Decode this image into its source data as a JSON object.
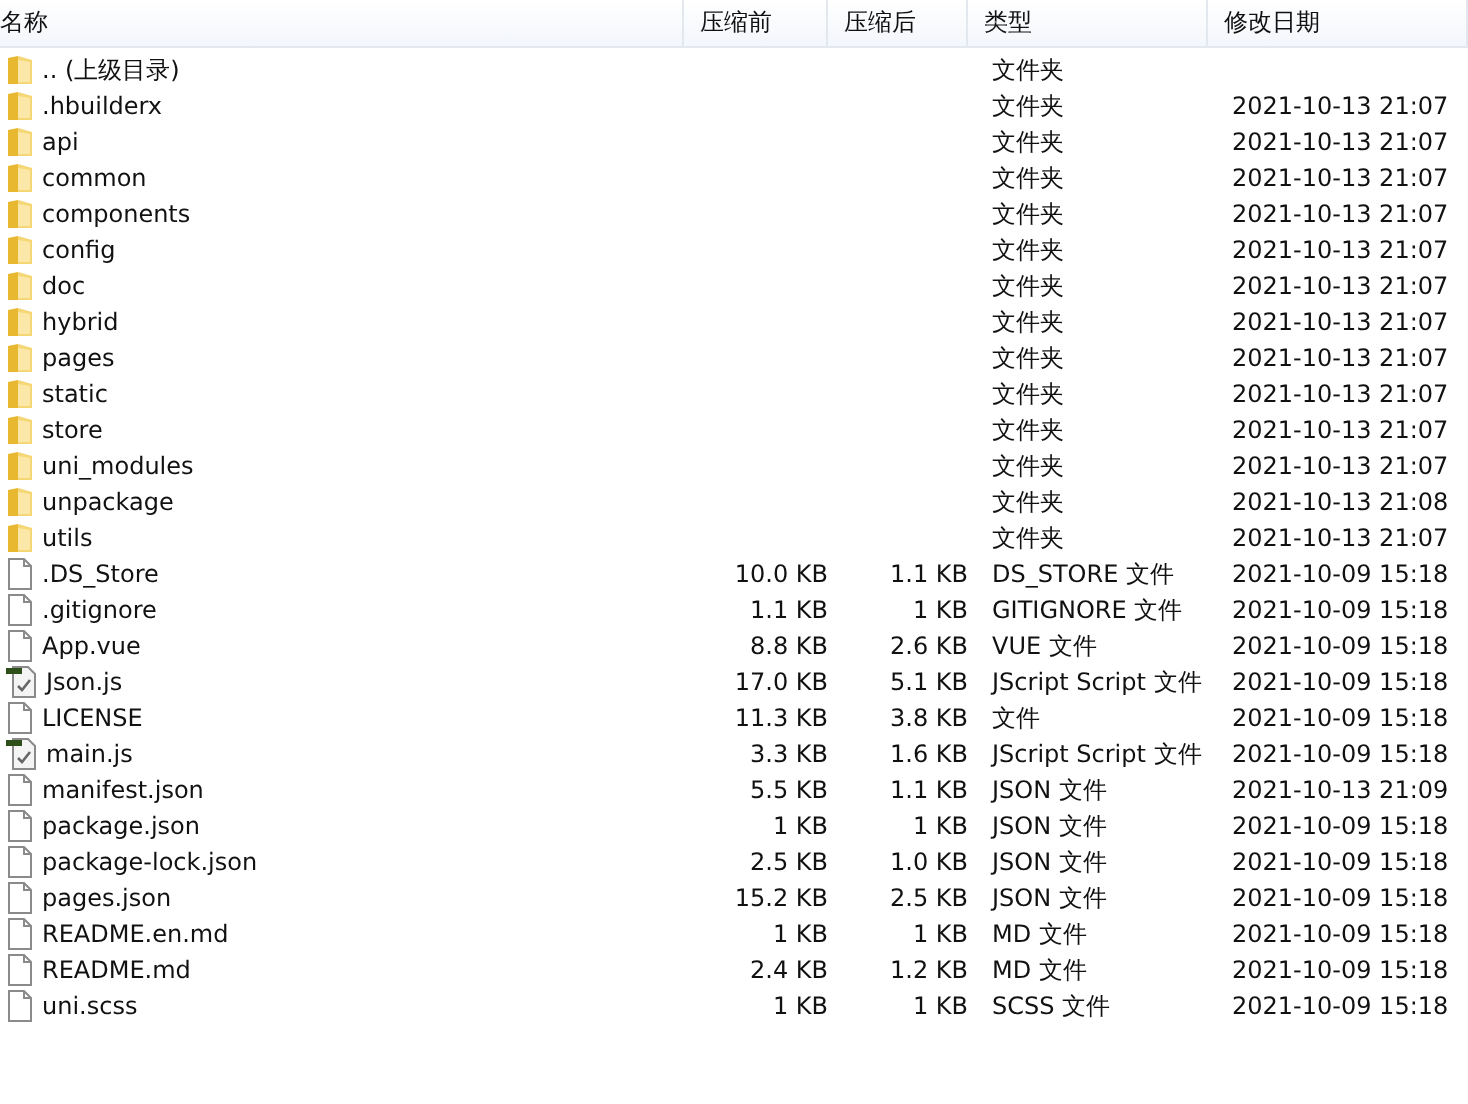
{
  "columns": [
    "名称",
    "压缩前",
    "压缩后",
    "类型",
    "修改日期"
  ],
  "rows": [
    {
      "kind": "folder",
      "name": ".. (上级目录)",
      "before": "",
      "after": "",
      "type": "文件夹",
      "date": ""
    },
    {
      "kind": "folder",
      "name": ".hbuilderx",
      "before": "",
      "after": "",
      "type": "文件夹",
      "date": "2021-10-13 21:07"
    },
    {
      "kind": "folder",
      "name": "api",
      "before": "",
      "after": "",
      "type": "文件夹",
      "date": "2021-10-13 21:07"
    },
    {
      "kind": "folder",
      "name": "common",
      "before": "",
      "after": "",
      "type": "文件夹",
      "date": "2021-10-13 21:07"
    },
    {
      "kind": "folder",
      "name": "components",
      "before": "",
      "after": "",
      "type": "文件夹",
      "date": "2021-10-13 21:07"
    },
    {
      "kind": "folder",
      "name": "config",
      "before": "",
      "after": "",
      "type": "文件夹",
      "date": "2021-10-13 21:07"
    },
    {
      "kind": "folder",
      "name": "doc",
      "before": "",
      "after": "",
      "type": "文件夹",
      "date": "2021-10-13 21:07"
    },
    {
      "kind": "folder",
      "name": "hybrid",
      "before": "",
      "after": "",
      "type": "文件夹",
      "date": "2021-10-13 21:07"
    },
    {
      "kind": "folder",
      "name": "pages",
      "before": "",
      "after": "",
      "type": "文件夹",
      "date": "2021-10-13 21:07"
    },
    {
      "kind": "folder",
      "name": "static",
      "before": "",
      "after": "",
      "type": "文件夹",
      "date": "2021-10-13 21:07"
    },
    {
      "kind": "folder",
      "name": "store",
      "before": "",
      "after": "",
      "type": "文件夹",
      "date": "2021-10-13 21:07"
    },
    {
      "kind": "folder",
      "name": "uni_modules",
      "before": "",
      "after": "",
      "type": "文件夹",
      "date": "2021-10-13 21:07"
    },
    {
      "kind": "folder",
      "name": "unpackage",
      "before": "",
      "after": "",
      "type": "文件夹",
      "date": "2021-10-13 21:08"
    },
    {
      "kind": "folder",
      "name": "utils",
      "before": "",
      "after": "",
      "type": "文件夹",
      "date": "2021-10-13 21:07"
    },
    {
      "kind": "file",
      "name": ".DS_Store",
      "before": "10.0 KB",
      "after": "1.1 KB",
      "type": "DS_STORE 文件",
      "date": "2021-10-09 15:18"
    },
    {
      "kind": "file",
      "name": ".gitignore",
      "before": "1.1 KB",
      "after": "1 KB",
      "type": "GITIGNORE 文件",
      "date": "2021-10-09 15:18"
    },
    {
      "kind": "file",
      "name": "App.vue",
      "before": "8.8 KB",
      "after": "2.6 KB",
      "type": "VUE 文件",
      "date": "2021-10-09 15:18"
    },
    {
      "kind": "script",
      "name": "Json.js",
      "before": "17.0 KB",
      "after": "5.1 KB",
      "type": "JScript Script 文件",
      "date": "2021-10-09 15:18"
    },
    {
      "kind": "file",
      "name": "LICENSE",
      "before": "11.3 KB",
      "after": "3.8 KB",
      "type": "文件",
      "date": "2021-10-09 15:18"
    },
    {
      "kind": "script",
      "name": "main.js",
      "before": "3.3 KB",
      "after": "1.6 KB",
      "type": "JScript Script 文件",
      "date": "2021-10-09 15:18"
    },
    {
      "kind": "file",
      "name": "manifest.json",
      "before": "5.5 KB",
      "after": "1.1 KB",
      "type": "JSON 文件",
      "date": "2021-10-13 21:09"
    },
    {
      "kind": "file",
      "name": "package.json",
      "before": "1 KB",
      "after": "1 KB",
      "type": "JSON 文件",
      "date": "2021-10-09 15:18"
    },
    {
      "kind": "file",
      "name": "package-lock.json",
      "before": "2.5 KB",
      "after": "1.0 KB",
      "type": "JSON 文件",
      "date": "2021-10-09 15:18"
    },
    {
      "kind": "file",
      "name": "pages.json",
      "before": "15.2 KB",
      "after": "2.5 KB",
      "type": "JSON 文件",
      "date": "2021-10-09 15:18"
    },
    {
      "kind": "file",
      "name": "README.en.md",
      "before": "1 KB",
      "after": "1 KB",
      "type": "MD 文件",
      "date": "2021-10-09 15:18"
    },
    {
      "kind": "file",
      "name": "README.md",
      "before": "2.4 KB",
      "after": "1.2 KB",
      "type": "MD 文件",
      "date": "2021-10-09 15:18"
    },
    {
      "kind": "file",
      "name": "uni.scss",
      "before": "1 KB",
      "after": "1 KB",
      "type": "SCSS 文件",
      "date": "2021-10-09 15:18"
    }
  ]
}
